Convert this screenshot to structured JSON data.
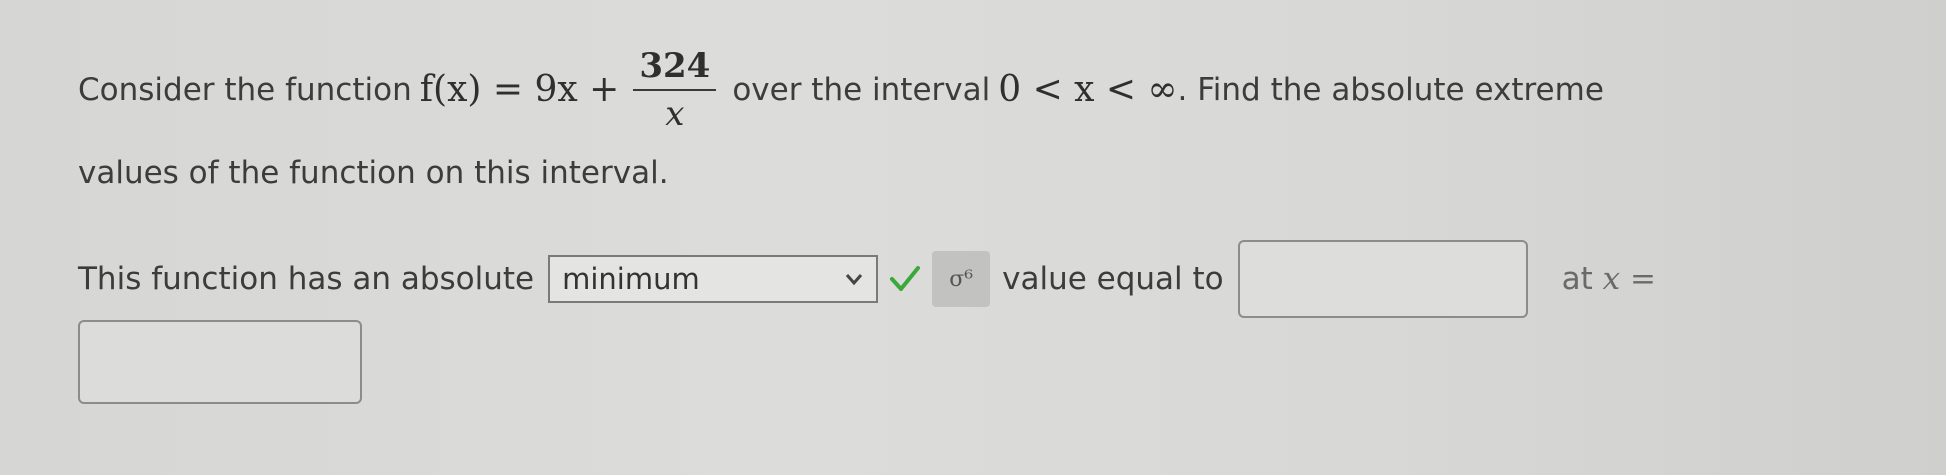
{
  "problem": {
    "intro": "Consider the function",
    "function_lhs": "f(x) = 9x +",
    "fraction_numerator": "324",
    "fraction_denominator": "x",
    "interval_text": "over the interval",
    "interval_math": "0 < x < ∞",
    "task": ". Find the absolute extreme",
    "line2": "values of the function on this interval."
  },
  "answer": {
    "prefix": "This function has an absolute",
    "selected_option": "minimum",
    "correct_icon": "check-icon",
    "symbol_button_icon": "math-symbol-icon",
    "symbol_button_label": "σ⁶",
    "value_text": "value equal to",
    "value_input": "",
    "at_text": "at",
    "at_var": "x =",
    "x_input": ""
  },
  "colors": {
    "check_green": "#3aa93a",
    "text": "#3c3c3c",
    "border": "#7a7a7a"
  }
}
